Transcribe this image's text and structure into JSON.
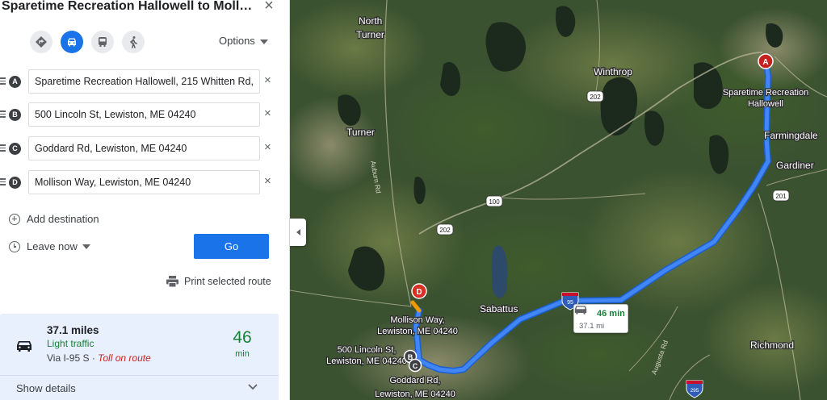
{
  "directions": {
    "title": "Sparetime Recreation Hallowell to Moll…",
    "close_glyph": "×",
    "options_label": "Options",
    "modes": [
      "best-route-icon",
      "car-icon",
      "transit-icon",
      "walk-icon"
    ],
    "active_mode": "car",
    "waypoints": [
      {
        "letter": "A",
        "value": "Sparetime Recreation Hallowell, 215 Whitten Rd,"
      },
      {
        "letter": "B",
        "value": "500 Lincoln St, Lewiston, ME 04240"
      },
      {
        "letter": "C",
        "value": "Goddard Rd, Lewiston, ME 04240"
      },
      {
        "letter": "D",
        "value": "Mollison Way, Lewiston, ME 04240"
      }
    ],
    "clear_glyph": "×",
    "add_destination_label": "Add destination",
    "leave_now_label": "Leave now",
    "go_label": "Go",
    "print_label": "Print selected route"
  },
  "route": {
    "distance": "37.1 miles",
    "traffic": "Light traffic",
    "via": "Via I-95 S",
    "separator": " · ",
    "toll": "Toll on route",
    "duration_value": "46",
    "duration_unit": "min",
    "show_details_label": "Show details"
  },
  "map": {
    "places": {
      "north_turner_1": "North",
      "north_turner_2": "Turner",
      "turner": "Turner",
      "winthrop": "Winthrop",
      "farmingdale": "Farmingdale",
      "gardiner": "Gardiner",
      "sabattus": "Sabattus",
      "richmond": "Richmond",
      "origin_1": "Sparetime Recreation",
      "origin_2": "Hallowell",
      "mollison_1": "Mollison Way,",
      "mollison_2": "Lewiston, ME 04240",
      "lincoln_1": "500 Lincoln St,",
      "lincoln_2": "Lewiston, ME 04240",
      "goddard_1": "Goddard Rd,",
      "goddard_2": "Lewiston, ME 04240"
    },
    "roads": {
      "auburn_rd": "Auburn Rd",
      "augusta_rd": "Augusta Rd",
      "r202_a": "202",
      "r202_b": "202",
      "r100": "100",
      "r201": "201",
      "i95": "95",
      "i295": "295"
    },
    "markers": {
      "a": "A",
      "b": "B",
      "c": "C",
      "d": "D"
    },
    "eta_time": "46 min",
    "eta_distance": "37.1 mi",
    "route_color": "#4285f4",
    "imagery": "satellite"
  }
}
